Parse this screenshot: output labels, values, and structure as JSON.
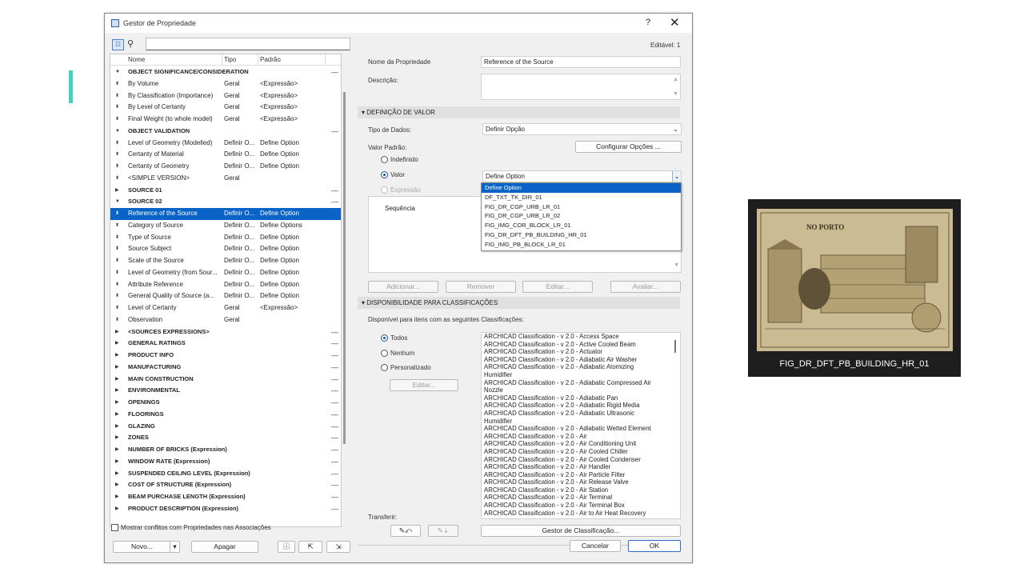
{
  "window": {
    "title": "Gestor de Propriedade",
    "help": "?",
    "close": "✕"
  },
  "left": {
    "columns": {
      "name": "Nome",
      "type": "Tipo",
      "default": "Padrão"
    },
    "rows": [
      {
        "g": true,
        "arrow": "▼",
        "name": "OBJECT SIGNIFICANCE/CONSIDERATION",
        "type": "",
        "def": "",
        "m": "—"
      },
      {
        "g": false,
        "arrow": "⬍",
        "name": "By Volume",
        "type": "Geral",
        "def": "<Expressão>",
        "m": ""
      },
      {
        "g": false,
        "arrow": "⬍",
        "name": "By Classification (Importance)",
        "type": "Geral",
        "def": "<Expressão>",
        "m": ""
      },
      {
        "g": false,
        "arrow": "⬍",
        "name": "By Level of Certanty",
        "type": "Geral",
        "def": "<Expressão>",
        "m": ""
      },
      {
        "g": false,
        "arrow": "⬍",
        "name": "Final Weight (to whole model)",
        "type": "Geral",
        "def": "<Expressão>",
        "m": ""
      },
      {
        "g": true,
        "arrow": "▼",
        "name": "OBJECT VALIDATION",
        "type": "",
        "def": "",
        "m": "—"
      },
      {
        "g": false,
        "arrow": "⬍",
        "name": "Level of Geometry (Modelled)",
        "type": "Definir O...",
        "def": "Define Option",
        "m": ""
      },
      {
        "g": false,
        "arrow": "⬍",
        "name": "Certanty of Material",
        "type": "Definir O...",
        "def": "Define Option",
        "m": ""
      },
      {
        "g": false,
        "arrow": "⬍",
        "name": "Certanty of Geometry",
        "type": "Definir O...",
        "def": "Define Option",
        "m": ""
      },
      {
        "g": false,
        "arrow": "⬍",
        "name": "<SIMPLE VERSION>",
        "type": "Geral",
        "def": "",
        "m": ""
      },
      {
        "g": true,
        "arrow": "▶",
        "name": "SOURCE 01",
        "type": "",
        "def": "",
        "m": "—"
      },
      {
        "g": true,
        "arrow": "▼",
        "name": "SOURCE 02",
        "type": "",
        "def": "",
        "m": "—"
      },
      {
        "g": false,
        "sel": true,
        "arrow": "⬍",
        "name": "Reference of the Source",
        "type": "Definir O...",
        "def": "Define Option",
        "m": ""
      },
      {
        "g": false,
        "arrow": "⬍",
        "name": "Category of Source",
        "type": "Definir O...",
        "def": "Define Options",
        "m": ""
      },
      {
        "g": false,
        "arrow": "⬍",
        "name": "Type of Source",
        "type": "Definir O...",
        "def": "Define Option",
        "m": ""
      },
      {
        "g": false,
        "arrow": "⬍",
        "name": "Source Subject",
        "type": "Definir O...",
        "def": "Define Option",
        "m": ""
      },
      {
        "g": false,
        "arrow": "⬍",
        "name": "Scale of the Source",
        "type": "Definir O...",
        "def": "Define Option",
        "m": ""
      },
      {
        "g": false,
        "arrow": "⬍",
        "name": "Level of Geometry (from Sour...",
        "type": "Definir O...",
        "def": "Define Option",
        "m": ""
      },
      {
        "g": false,
        "arrow": "⬍",
        "name": "Attribute Reference",
        "type": "Definir O...",
        "def": "Define Option",
        "m": ""
      },
      {
        "g": false,
        "arrow": "⬍",
        "name": "General Quality of Source (a...",
        "type": "Definir O...",
        "def": "Define Option",
        "m": ""
      },
      {
        "g": false,
        "arrow": "⬍",
        "name": "Level of Certanty",
        "type": "Geral",
        "def": "<Expressão>",
        "m": ""
      },
      {
        "g": false,
        "arrow": "⬍",
        "name": "Observation",
        "type": "Geral",
        "def": "",
        "m": ""
      },
      {
        "g": true,
        "arrow": "▶",
        "name": "<SOURCES EXPRESSIONS>",
        "type": "",
        "def": "",
        "m": "—"
      },
      {
        "g": true,
        "arrow": "▶",
        "name": "GENERAL RATINGS",
        "type": "",
        "def": "",
        "m": "—"
      },
      {
        "g": true,
        "arrow": "▶",
        "name": "PRODUCT INFO",
        "type": "",
        "def": "",
        "m": "—"
      },
      {
        "g": true,
        "arrow": "▶",
        "name": "MANUFACTURING",
        "type": "",
        "def": "",
        "m": "—"
      },
      {
        "g": true,
        "arrow": "▶",
        "name": "MAIN CONSTRUCTION",
        "type": "",
        "def": "",
        "m": "—"
      },
      {
        "g": true,
        "arrow": "▶",
        "name": "ENVIRONMENTAL",
        "type": "",
        "def": "",
        "m": "—"
      },
      {
        "g": true,
        "arrow": "▶",
        "name": "OPENINGS",
        "type": "",
        "def": "",
        "m": "—"
      },
      {
        "g": true,
        "arrow": "▶",
        "name": "FLOORINGS",
        "type": "",
        "def": "",
        "m": "—"
      },
      {
        "g": true,
        "arrow": "▶",
        "name": "GLAZING",
        "type": "",
        "def": "",
        "m": "—"
      },
      {
        "g": true,
        "arrow": "▶",
        "name": "ZONES",
        "type": "",
        "def": "",
        "m": "—"
      },
      {
        "g": true,
        "arrow": "▶",
        "name": "NUMBER OF BRICKS (Expression)",
        "type": "",
        "def": "",
        "m": "—"
      },
      {
        "g": true,
        "arrow": "▶",
        "name": "WINDOW RATE (Expression)",
        "type": "",
        "def": "",
        "m": "—"
      },
      {
        "g": true,
        "arrow": "▶",
        "name": "SUSPENDED CEILING LEVEL (Expression)",
        "type": "",
        "def": "",
        "m": "—"
      },
      {
        "g": true,
        "arrow": "▶",
        "name": "COST OF STRUCTURE (Expression)",
        "type": "",
        "def": "",
        "m": "—"
      },
      {
        "g": true,
        "arrow": "▶",
        "name": "BEAM PURCHASE LENGTH (Expression)",
        "type": "",
        "def": "",
        "m": "—"
      },
      {
        "g": true,
        "arrow": "▶",
        "name": "PRODUCT DESCRIPTION (Expression)",
        "type": "",
        "def": "",
        "m": "—"
      }
    ],
    "show_conflicts": "Mostrar conflitos com Propriedades nas Associações",
    "new_btn": "Novo...",
    "delete_btn": "Apagar"
  },
  "right": {
    "editable": "Editável: 1",
    "name_label": "Nome da Propriedade",
    "name_value": "Reference of the Source",
    "desc_label": "Descrição:",
    "sec_value": "DEFINIÇÃO DE VALOR",
    "type_label": "Tipo de Dados:",
    "type_value": "Definir Opção",
    "default_label": "Valor Padrão:",
    "config_btn": "Configurar Opções ...",
    "opt_undefined": "Indefinido",
    "opt_value": "Valor",
    "opt_expression": "Expressão",
    "sequence": "Sequência",
    "value_select": "Define Option",
    "dropdown": [
      "Define Option",
      "DF_TXT_TK_DIR_01",
      "FIG_DR_CGP_URB_LR_01",
      "FIG_DR_CGP_URB_LR_02",
      "FIG_IMG_COR_BLOCK_LR_01",
      "FIG_DR_DFT_PB_BUILDING_HR_01",
      "FIG_IMG_PB_BLOCK_LR_01"
    ],
    "add_btn": "Adicionar...",
    "remove_btn": "Remover",
    "edit_btn": "Editar...",
    "eval_btn": "Avaliar...",
    "sec_avail": "DISPONIBILIDADE PARA CLASSIFICAÇÕES",
    "avail_text": "Disponível para itens com as seguintes Classificações:",
    "all": "Todos",
    "none": "Nenhum",
    "custom": "Personalizado",
    "edit2_btn": "Editar...",
    "classes": [
      "ARCHICAD Classification - v 2.0 - Access Space",
      "ARCHICAD Classification - v 2.0 - Active Cooled Beam",
      "ARCHICAD Classification - v 2.0 - Actuator",
      "ARCHICAD Classification - v 2.0 - Adiabatic Air Washer",
      "ARCHICAD Classification - v 2.0 - Adiabatic Atomizing",
      "Humidifier",
      "ARCHICAD Classification - v 2.0 - Adiabatic Compressed Air",
      "Nozzle",
      "ARCHICAD Classification - v 2.0 - Adiabatic Pan",
      "ARCHICAD Classification - v 2.0 - Adiabatic Rigid Media",
      "ARCHICAD Classification - v 2.0 - Adiabatic Ultrasonic",
      "Humidifier",
      "ARCHICAD Classification - v 2.0 - Adiabatic Wetted Element",
      "ARCHICAD Classification - v 2.0 - Air",
      "ARCHICAD Classification - v 2.0 - Air Conditioning Unit",
      "ARCHICAD Classification - v 2.0 - Air Cooled Chiller",
      "ARCHICAD Classification - v 2.0 - Air Cooled Condenser",
      "ARCHICAD Classification - v 2.0 - Air Handler",
      "ARCHICAD Classification - v 2.0 - Air Particle Filter",
      "ARCHICAD Classification - v 2.0 - Air Release Valve",
      "ARCHICAD Classification - v 2.0 - Air Station",
      "ARCHICAD Classification - v 2.0 - Air Terminal",
      "ARCHICAD Classification - v 2.0 - Air Terminal Box",
      "ARCHICAD Classification - v 2.0 - Air to Air Heat Recovery"
    ],
    "transfer": "Transferir:",
    "manager_btn": "Gestor de Classificação...",
    "cancel_btn": "Cancelar",
    "ok_btn": "OK"
  },
  "card": {
    "caption": "FIG_DR_DFT_PB_BUILDING_HR_01",
    "image_heading": "NO PORTO"
  }
}
